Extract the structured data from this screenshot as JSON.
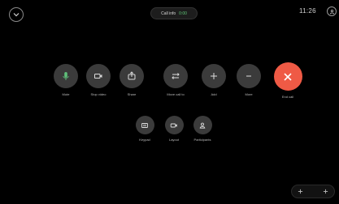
{
  "top_bar": {
    "call_label": "Call info",
    "call_time": "0:00",
    "clock": "11:26"
  },
  "controls": [
    {
      "id": "mute",
      "label": "Mute",
      "icon": "microphone-icon"
    },
    {
      "id": "stop-video",
      "label": "Stop video",
      "icon": "video-camera-icon"
    },
    {
      "id": "share",
      "label": "Share",
      "icon": "share-icon"
    },
    {
      "id": "move",
      "label": "Move call to",
      "icon": "transfer-arrows-icon"
    },
    {
      "id": "add",
      "label": "Add",
      "icon": "plus-icon"
    },
    {
      "id": "more",
      "label": "More",
      "icon": "ellipsis-icon"
    },
    {
      "id": "end",
      "label": "End call",
      "icon": "close-icon"
    }
  ],
  "secondary_controls": [
    {
      "id": "keypad",
      "label": "Keypad",
      "icon": "keypad-icon"
    },
    {
      "id": "layout",
      "label": "Layout",
      "icon": "camera-icon"
    },
    {
      "id": "participants",
      "label": "Participants",
      "icon": "participants-icon"
    }
  ],
  "colors": {
    "background": "#000000",
    "button": "#3b3b3b",
    "end_call": "#ef5a45",
    "timer": "#5fc877"
  }
}
